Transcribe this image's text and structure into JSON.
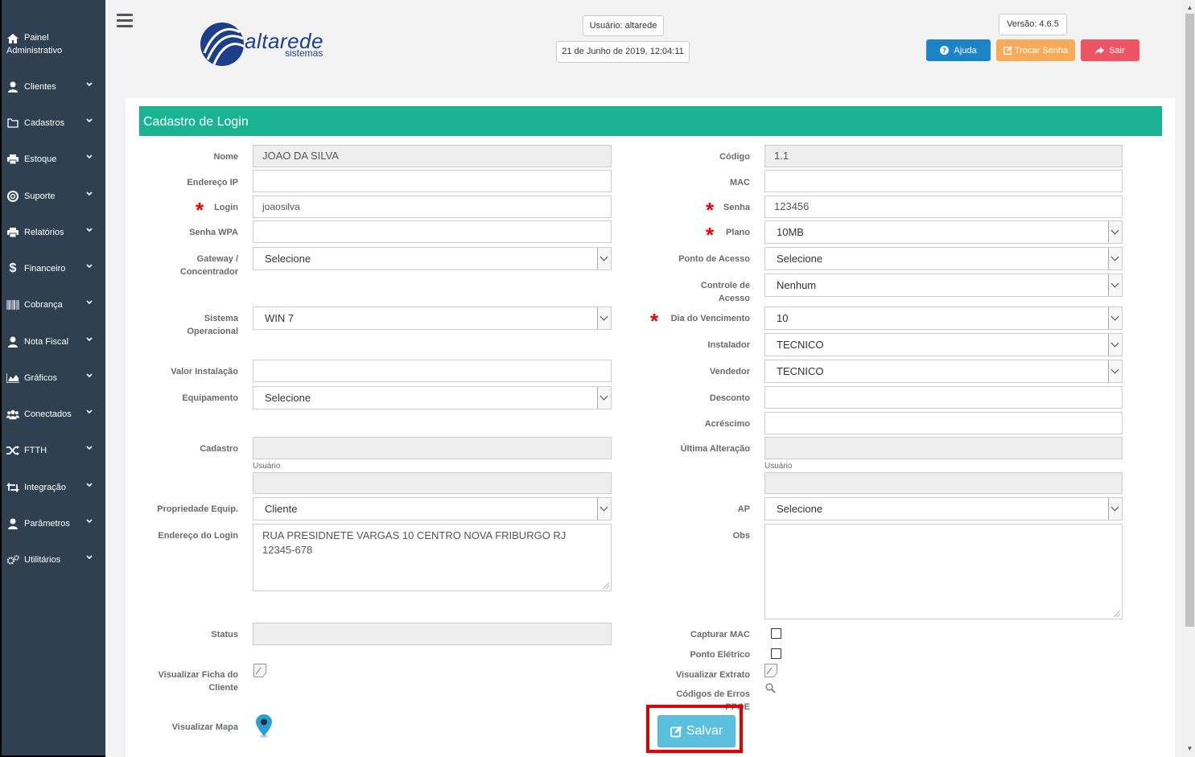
{
  "sidebar": {
    "items": [
      {
        "label": "Painel",
        "label2": "Administrativo"
      },
      {
        "label": "Clientes"
      },
      {
        "label": "Cadastros"
      },
      {
        "label": "Estoque"
      },
      {
        "label": "Suporte"
      },
      {
        "label": "Relatórios"
      },
      {
        "label": "Financeiro"
      },
      {
        "label": "Cobrança"
      },
      {
        "label": "Nota Fiscal"
      },
      {
        "label": "Gráficos"
      },
      {
        "label": "Conectados"
      },
      {
        "label": "FTTH"
      },
      {
        "label": "Integração"
      },
      {
        "label": "Parâmetros"
      },
      {
        "label": "Utilitários"
      }
    ]
  },
  "header": {
    "logo_name": "altarede",
    "logo_sub": "sistemas",
    "user": "Usuário: altarede",
    "datetime": "21 de Junho de 2019, 12:04:11",
    "version": "Versão: 4.6.5",
    "help_label": "Ajuda",
    "change_pw_label": "Trocar Senha",
    "logout_label": "Sair"
  },
  "form": {
    "title": "Cadastro de Login",
    "left": {
      "nome_label": "Nome",
      "nome_value": "JOAO DA SILVA",
      "ip_label": "Endereço IP",
      "ip_value": "",
      "login_label": "Login",
      "login_value": "joaosilva",
      "wpa_label": "Senha WPA",
      "wpa_value": "",
      "gateway_label1": "Gateway /",
      "gateway_label2": "Concentrador",
      "gateway_value": "Selecione",
      "so_label1": "Sistema",
      "so_label2": "Operacional",
      "so_value": "WIN 7",
      "valor_label": "Valor Instalação",
      "valor_value": "",
      "equip_label": "Equipamento",
      "equip_value": "Selecione",
      "cadastro_label": "Cadastro",
      "cadastro_value": "",
      "usuario_label": "Usuário",
      "usuario_value": "",
      "prop_label": "Propriedade Equip.",
      "prop_value": "Cliente",
      "endereco_label": "Endereço do Login",
      "endereco_line1": "RUA PRESIDNETE VARGAS 10 CENTRO NOVA FRIBURGO RJ",
      "endereco_line2": "12345-678",
      "status_label": "Status",
      "status_value": "",
      "ficha_label1": "Visualizar Ficha do",
      "ficha_label2": "Cliente",
      "mapa_label": "Visualizar Mapa"
    },
    "right": {
      "codigo_label": "Código",
      "codigo_value": "1.1",
      "mac_label": "MAC",
      "mac_value": "",
      "senha_label": "Senha",
      "senha_value": "123456",
      "plano_label": "Plano",
      "plano_value": "10MB",
      "ponto_label": "Ponto de Acesso",
      "ponto_value": "Selecione",
      "controle_label1": "Controle de",
      "controle_label2": "Acesso",
      "controle_value": "Nenhum",
      "dia_label": "Dia do Vencimento",
      "dia_value": "10",
      "instalador_label": "Instalador",
      "instalador_value": "TECNICO",
      "vendedor_label": "Vendedor",
      "vendedor_value": "TECNICO",
      "desconto_label": "Desconto",
      "desconto_value": "",
      "acrescimo_label": "Acréscimo",
      "acrescimo_value": "",
      "ultima_label": "Última Alteração",
      "ultima_value": "",
      "usuario_label": "Usuário",
      "usuario_value": "",
      "ap_label": "AP",
      "ap_value": "Selecione",
      "obs_label": "Obs",
      "obs_value": "",
      "capturar_label": "Capturar MAC",
      "eletrico_label": "Ponto Elétrico",
      "extrato_label": "Visualizar Extrato",
      "erros_label1": "Códigos de Erros",
      "erros_label2": "PPOE"
    },
    "save_label": "Salvar"
  },
  "colors": {
    "sidebar": "#2f4050",
    "header_green": "#1ab394",
    "help_blue": "#1c84c6",
    "change_orange": "#f8ac59",
    "logout_red": "#ed5565",
    "save_blue": "#5bc0de",
    "highlight_red": "#e00000"
  }
}
